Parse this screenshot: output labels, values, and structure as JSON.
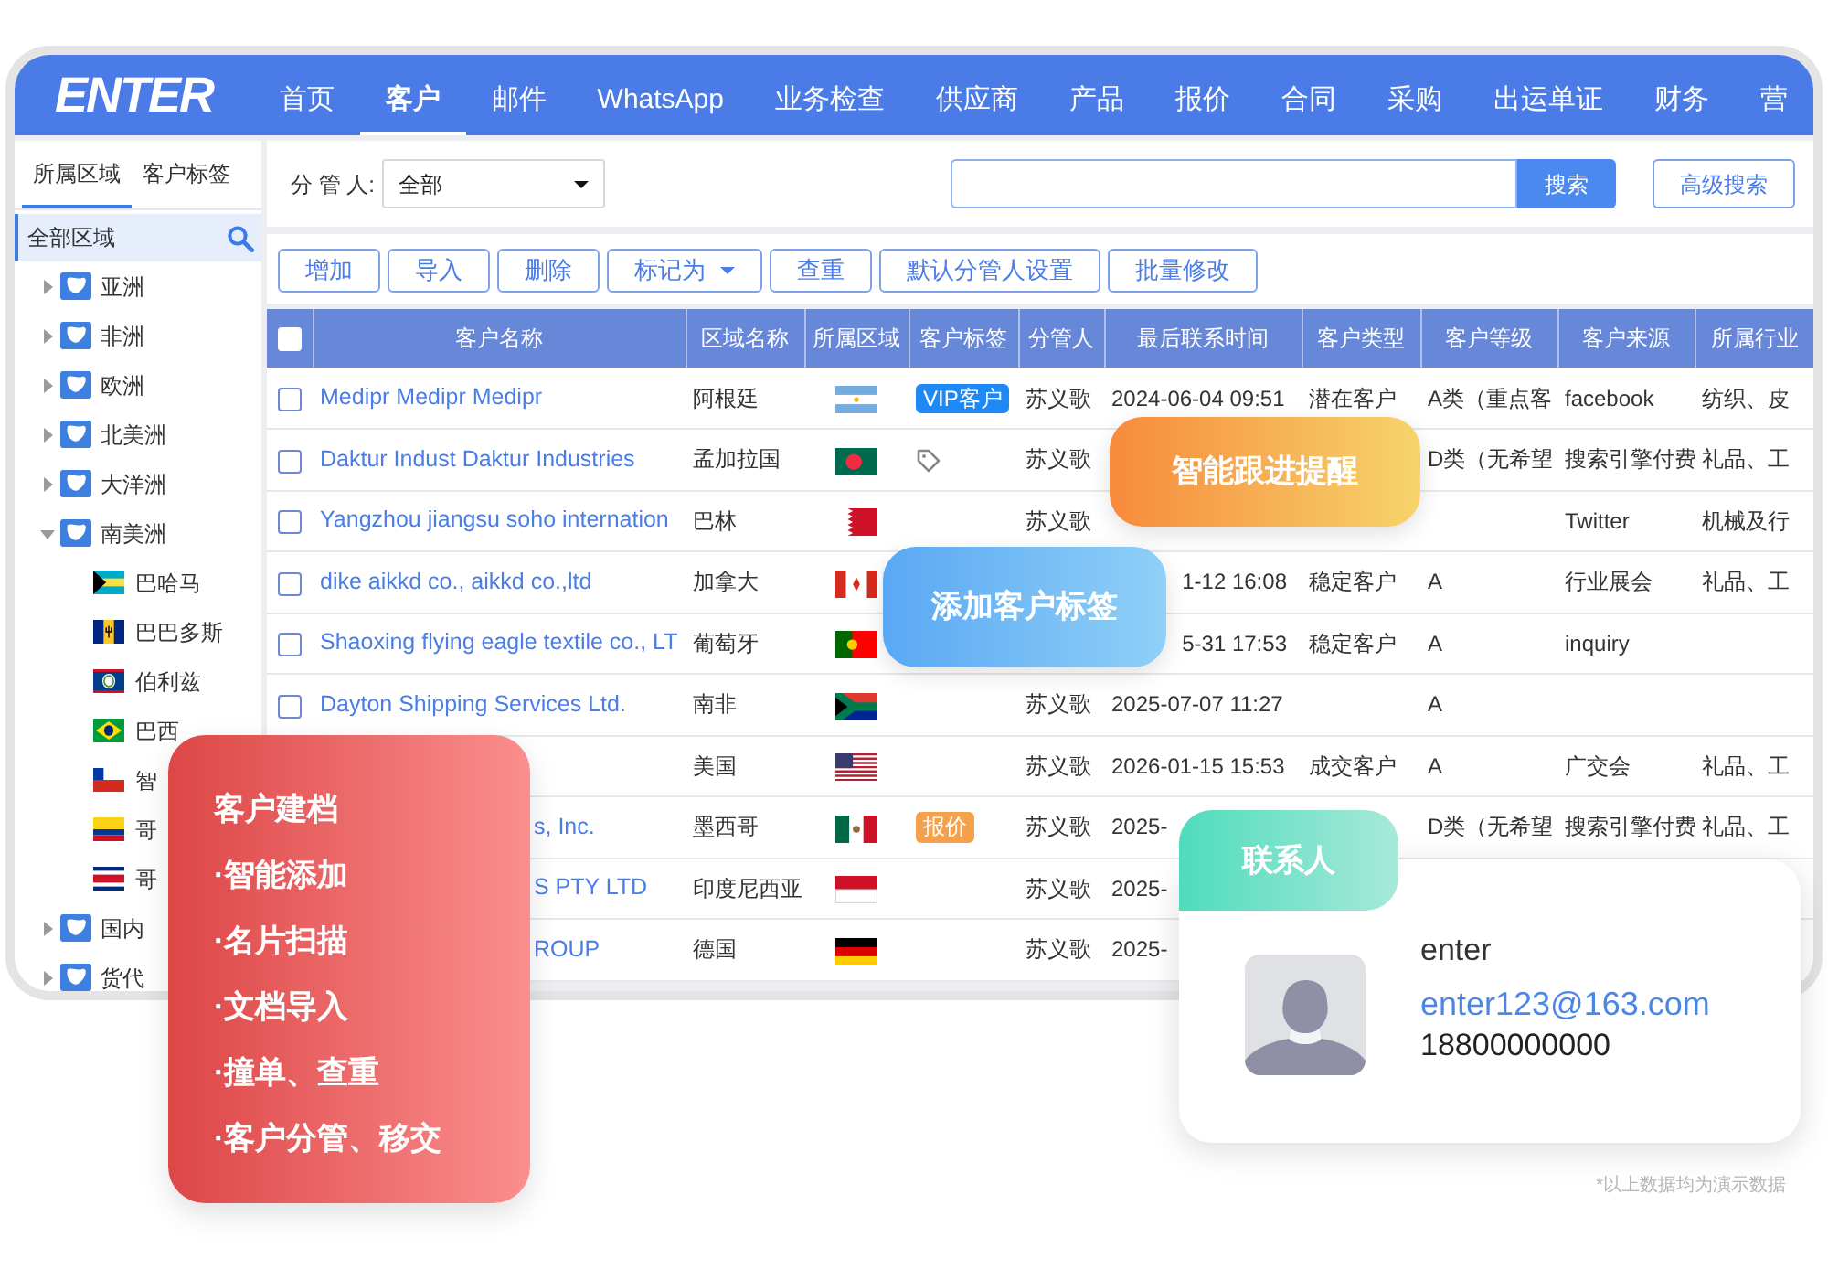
{
  "nav": {
    "logo": "ENTER",
    "items": [
      {
        "label": "首页",
        "selected": false
      },
      {
        "label": "客户",
        "selected": true
      },
      {
        "label": "邮件",
        "selected": false
      },
      {
        "label": "WhatsApp",
        "selected": false
      },
      {
        "label": "业务检查",
        "selected": false
      },
      {
        "label": "供应商",
        "selected": false
      },
      {
        "label": "产品",
        "selected": false
      },
      {
        "label": "报价",
        "selected": false
      },
      {
        "label": "合同",
        "selected": false
      },
      {
        "label": "采购",
        "selected": false
      },
      {
        "label": "出运单证",
        "selected": false
      },
      {
        "label": "财务",
        "selected": false
      },
      {
        "label": "营",
        "selected": false
      }
    ]
  },
  "sidebar": {
    "tabs": [
      {
        "label": "所属区域",
        "selected": true
      },
      {
        "label": "客户标签",
        "selected": false
      }
    ],
    "root": {
      "label": "全部区域",
      "selected": true
    },
    "tree": [
      {
        "label": "亚洲",
        "expanded": false
      },
      {
        "label": "非洲",
        "expanded": false
      },
      {
        "label": "欧洲",
        "expanded": false
      },
      {
        "label": "北美洲",
        "expanded": false
      },
      {
        "label": "大洋洲",
        "expanded": false
      },
      {
        "label": "南美洲",
        "expanded": true,
        "children": [
          {
            "label": "巴哈马"
          },
          {
            "label": "巴巴多斯"
          },
          {
            "label": "伯利兹"
          },
          {
            "label": "巴西"
          },
          {
            "label": "智"
          },
          {
            "label": "哥"
          },
          {
            "label": "哥"
          }
        ]
      },
      {
        "label": "国内",
        "expanded": false
      },
      {
        "label": "货代",
        "expanded": false
      }
    ]
  },
  "filter": {
    "label": "分 管 人:",
    "owner_select": "全部",
    "search_button": "搜索",
    "advanced_button": "高级搜索"
  },
  "toolbar": [
    {
      "label": "增加"
    },
    {
      "label": "导入"
    },
    {
      "label": "删除"
    },
    {
      "label": "标记为",
      "dropdown": true
    },
    {
      "label": "查重"
    },
    {
      "label": "默认分管人设置"
    },
    {
      "label": "批量修改"
    }
  ],
  "table": {
    "all_checked": false,
    "columns": [
      "客户名称",
      "区域名称",
      "所属区域",
      "客户标签",
      "分管人",
      "最后联系时间",
      "客户类型",
      "客户等级",
      "客户来源",
      "所属行业"
    ],
    "rows": [
      {
        "selected": false,
        "name": "Medipr  Medipr  Medipr",
        "region": "阿根廷",
        "tag": {
          "kind": "badge",
          "label": "VIP客户",
          "color": "#1e88f5"
        },
        "owner": "苏义歌",
        "last_contact": "2024-06-04 09:51",
        "type": "潜在客户",
        "level": "A类（重点客",
        "source": "facebook",
        "industry": "纺织、皮"
      },
      {
        "selected": false,
        "name": "Daktur Indust  Daktur Industries",
        "region": "孟加拉国",
        "tag": {
          "kind": "icon"
        },
        "owner": "苏义歌",
        "level": "D类（无希望",
        "source": "搜索引擎付费",
        "industry": "礼品、工"
      },
      {
        "selected": false,
        "name": "Yangzhou jiangsu soho internation",
        "region": "巴林",
        "owner": "苏义歌",
        "source": "Twitter",
        "industry": "机械及行"
      },
      {
        "selected": false,
        "name": "dike aikkd co., aikkd co.,ltd",
        "region": "加拿大",
        "last_contact": "1-12 16:08",
        "type": "稳定客户",
        "level": "A",
        "source": "行业展会",
        "industry": "礼品、工"
      },
      {
        "selected": false,
        "name": "Shaoxing flying eagle textile co., LT",
        "region": "葡萄牙",
        "last_contact": "5-31 17:53",
        "type": "稳定客户",
        "level": "A",
        "source": "inquiry"
      },
      {
        "selected": false,
        "name": "Dayton Shipping Services Ltd.",
        "region": "南非",
        "owner": "苏义歌",
        "last_contact": "2025-07-07 11:27",
        "level": "A"
      },
      {
        "region": "美国",
        "owner": "苏义歌",
        "last_contact": "2026-01-15 15:53",
        "type": "成交客户",
        "level": "A",
        "source": "广交会",
        "industry": "礼品、工"
      },
      {
        "name": "s, Inc.",
        "region": "墨西哥",
        "tag": {
          "kind": "badge",
          "label": "报价",
          "color": "#f5a04a"
        },
        "owner": "苏义歌",
        "last_contact": "2025-",
        "level": "D类（无希望",
        "source": "搜索引擎付费",
        "industry": "礼品、工"
      },
      {
        "name": "S PTY LTD",
        "region": "印度尼西亚",
        "owner": "苏义歌",
        "last_contact": "2025-"
      },
      {
        "name": "ROUP",
        "region": "德国",
        "owner": "苏义歌",
        "last_contact": "2025-"
      }
    ]
  },
  "callouts": [
    {
      "kind": "banner",
      "label": "智能跟进提醒",
      "color": "#f78a3c"
    },
    {
      "kind": "banner",
      "label": "添加客户标签",
      "color": "#5aa8f4"
    },
    {
      "kind": "list",
      "title": "客户建档",
      "items": [
        "·智能添加",
        "·名片扫描",
        "·文档导入",
        "·撞单、查重",
        "·客户分管、移交"
      ],
      "color": "#dd4646"
    }
  ],
  "contact": {
    "tab": "联系人",
    "name": "enter",
    "email": "enter123@163.com",
    "phone": "18800000000"
  },
  "footnote": "*以上数据均为演示数据"
}
